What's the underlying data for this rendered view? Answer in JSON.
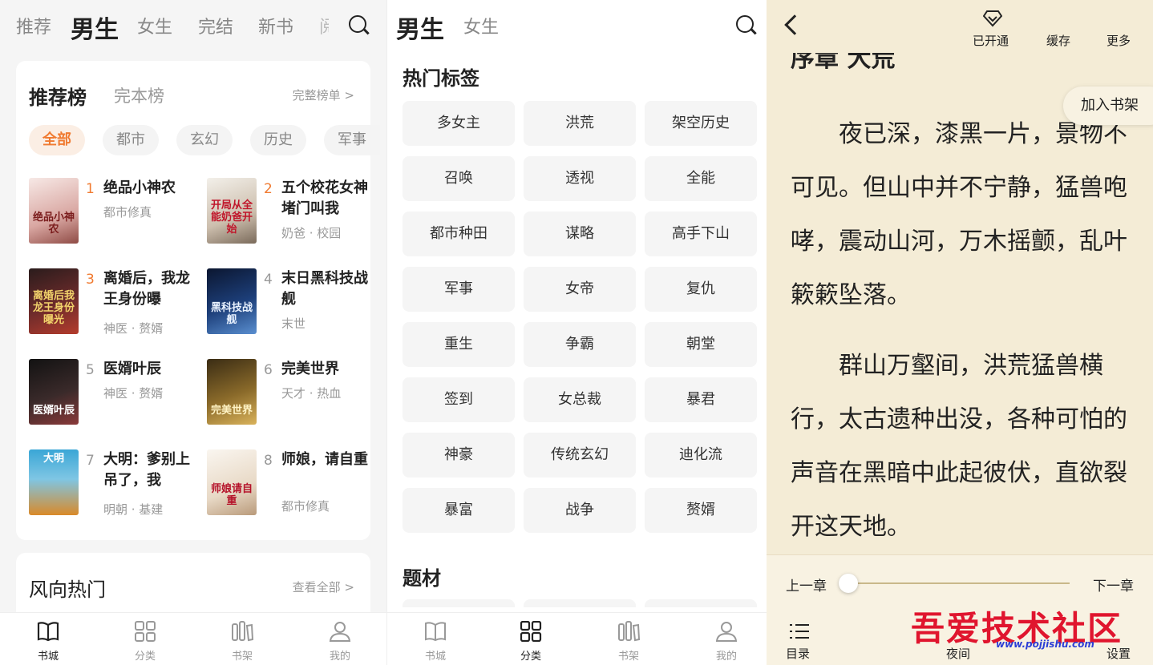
{
  "bookstore": {
    "top_tabs": [
      "推荐",
      "男生",
      "女生",
      "完结",
      "新书",
      "阅"
    ],
    "rank_card": {
      "title": "推荐榜",
      "alt_title": "完本榜",
      "more": "完整榜单 >",
      "chips": [
        "全部",
        "都市",
        "玄幻",
        "历史",
        "军事"
      ],
      "books": [
        {
          "rank": "1",
          "title": "绝品小神农",
          "meta": "都市修真",
          "cover_text": "绝品小神农"
        },
        {
          "rank": "2",
          "title": "五个校花女神堵门叫我",
          "meta": "奶爸 · 校园",
          "cover_text": "开局从全能奶爸开始"
        },
        {
          "rank": "3",
          "title": "离婚后，我龙王身份曝",
          "meta": "神医 · 赘婿",
          "cover_text": "离婚后我龙王身份曝光"
        },
        {
          "rank": "4",
          "title": "末日黑科技战舰",
          "meta": "末世",
          "cover_text": "黑科技战舰"
        },
        {
          "rank": "5",
          "title": "医婿叶辰",
          "meta": "神医 · 赘婿",
          "cover_text": "医婿叶辰"
        },
        {
          "rank": "6",
          "title": "完美世界",
          "meta": "天才 · 热血",
          "cover_text": "完美世界"
        },
        {
          "rank": "7",
          "title": "大明：爹别上吊了，我",
          "meta": "明朝 · 基建",
          "cover_text": "大明"
        },
        {
          "rank": "8",
          "title": "师娘，请自重",
          "meta": "都市修真",
          "cover_text": "师娘请自重"
        }
      ]
    },
    "hot_card": {
      "title": "风向热门",
      "more": "查看全部 >"
    }
  },
  "category": {
    "tabs": [
      "男生",
      "女生"
    ],
    "hot_tags_title": "热门标签",
    "tags": [
      "多女主",
      "洪荒",
      "架空历史",
      "召唤",
      "透视",
      "全能",
      "都市种田",
      "谋略",
      "高手下山",
      "军事",
      "女帝",
      "复仇",
      "重生",
      "争霸",
      "朝堂",
      "签到",
      "女总裁",
      "暴君",
      "神豪",
      "传统玄幻",
      "迪化流",
      "暴富",
      "战争",
      "赘婿"
    ],
    "subject_title": "题材"
  },
  "nav": {
    "items": [
      "书城",
      "分类",
      "书架",
      "我的"
    ]
  },
  "reader": {
    "top_buttons": [
      "已开通",
      "缓存",
      "更多"
    ],
    "add_shelf": "加入书架",
    "chapter_title": "序章 大荒",
    "paragraphs": [
      "夜已深，漆黑一片，景物不可见。但山中并不宁静，猛兽咆哮，震动山河，万木摇颤，乱叶簌簌坠落。",
      "群山万壑间，洪荒猛兽横行，太古遗种出没，各种可怕的声音在黑暗中此起彼伏，直欲裂开这天地。"
    ],
    "prev_chapter": "上一章",
    "next_chapter": "下一章",
    "progress": 0.0,
    "bottom_buttons": [
      "目录",
      "夜间",
      "设置"
    ],
    "watermark": "吾爱技术社区",
    "watermark_url": "www.pojjishu.com"
  },
  "colors": {
    "accent": "#f07a30",
    "reader_bg": "#f4ecd6",
    "watermark": "#e0152e"
  }
}
